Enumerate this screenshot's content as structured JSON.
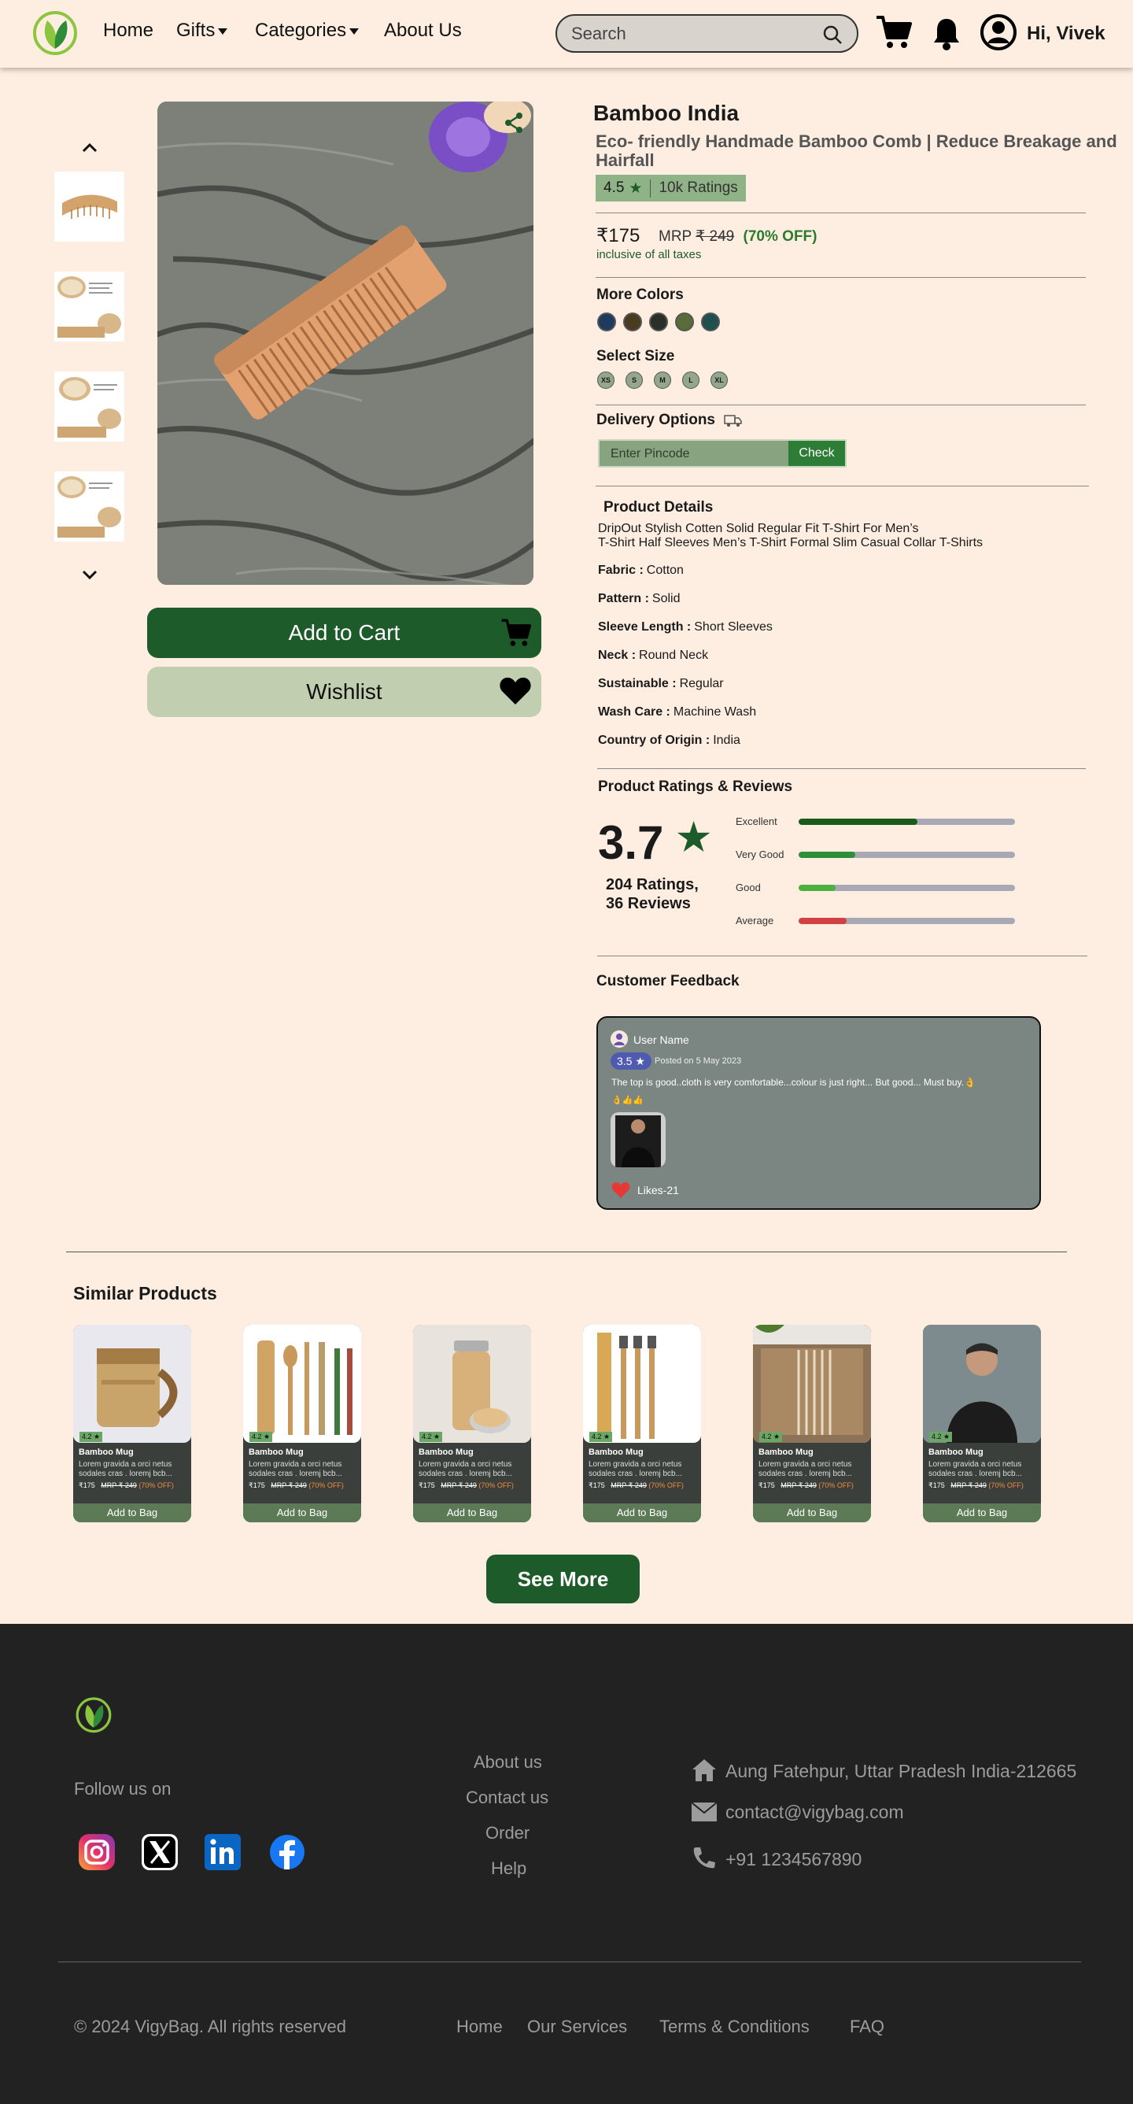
{
  "nav": {
    "home": "Home",
    "gifts": "Gifts",
    "categories": "Categories",
    "about": "About Us",
    "search_placeholder": "Search",
    "greeting": "Hi, Vivek"
  },
  "product": {
    "brand": "Bamboo India",
    "title": "Eco- friendly Handmade Bamboo Comb | Reduce Breakage and Hairfall",
    "rating": "4.5",
    "rating_count": "10k Ratings",
    "price": "₹175",
    "mrp_label": "MRP",
    "mrp_value": "₹ 249",
    "discount": "(70% OFF)",
    "tax_note": "inclusive of all taxes",
    "add_to_cart": "Add to Cart",
    "wishlist": "Wishlist"
  },
  "colors": {
    "title": "More Colors",
    "swatches": [
      "#1f3a5f",
      "#4a3a1f",
      "#2b2f2a",
      "#5a6b3a",
      "#1f4f4f"
    ]
  },
  "sizes": {
    "title": "Select Size",
    "options": [
      "XS",
      "S",
      "M",
      "L",
      "XL"
    ]
  },
  "delivery": {
    "title": "Delivery Options",
    "placeholder": "Enter Pincode",
    "check": "Check"
  },
  "details": {
    "title": "Product Details",
    "desc_line1": "DripOut Stylish Cotten Solid Regular Fit T-Shirt For Men’s",
    "desc_line2": "T-Shirt Half Sleeves Men’s T-Shirt Formal Slim Casual Collar T-Shirts",
    "attributes": [
      {
        "label": "Fabric :",
        "value": "Cotton"
      },
      {
        "label": "Pattern :",
        "value": "Solid"
      },
      {
        "label": "Sleeve Length :",
        "value": "Short Sleeves"
      },
      {
        "label": "Neck :",
        "value": "Round Neck"
      },
      {
        "label": "Sustainable :",
        "value": "Regular"
      },
      {
        "label": "Wash Care :",
        "value": "Machine Wash"
      },
      {
        "label": "Country of Origin :",
        "value": "India"
      }
    ]
  },
  "ratings": {
    "title": "Product Ratings & Reviews",
    "average": "3.7",
    "count_line1": "204 Ratings,",
    "count_line2": "36 Reviews",
    "bars": [
      {
        "label": "Excellent",
        "fraction": 0.55,
        "color": "#1a5a1a"
      },
      {
        "label": "Very Good",
        "fraction": 0.26,
        "color": "#2e8f38"
      },
      {
        "label": "Good",
        "fraction": 0.17,
        "color": "#4caf3e"
      },
      {
        "label": "Average",
        "fraction": 0.22,
        "color": "#d24141"
      }
    ]
  },
  "feedback": {
    "title": "Customer Feedback",
    "user": "User Name",
    "score": "3.5 ★",
    "date": "Posted on 5 May 2023",
    "text": "The top is good..cloth is very comfortable...colour is just right... But good... Must buy.👌",
    "emoji": "👌👍👍",
    "likes": "Likes-21"
  },
  "similar": {
    "title": "Similar Products",
    "see_more": "See More",
    "items": [
      {
        "rating": "4.2 ★",
        "name": "Bamboo Mug",
        "desc": "Lorem gravida a orci netus sodales cras . loremj bcb...",
        "price": "₹175",
        "mrp": "MRP ₹ 249",
        "off": "(70% OFF)",
        "button": "Add to Bag"
      },
      {
        "rating": "4.2 ★",
        "name": "Bamboo Mug",
        "desc": "Lorem gravida a orci netus sodales cras . loremj bcb...",
        "price": "₹175",
        "mrp": "MRP ₹ 249",
        "off": "(70% OFF)",
        "button": "Add to Bag"
      },
      {
        "rating": "4.2 ★",
        "name": "Bamboo Mug",
        "desc": "Lorem gravida a orci netus sodales cras . loremj bcb...",
        "price": "₹175",
        "mrp": "MRP ₹ 249",
        "off": "(70% OFF)",
        "button": "Add to Bag"
      },
      {
        "rating": "4.2 ★",
        "name": "Bamboo Mug",
        "desc": "Lorem gravida a orci netus sodales cras . loremj bcb...",
        "price": "₹175",
        "mrp": "MRP ₹ 249",
        "off": "(70% OFF)",
        "button": "Add to Bag"
      },
      {
        "rating": "4.2 ★",
        "name": "Bamboo Mug",
        "desc": "Lorem gravida a orci netus sodales cras . loremj bcb...",
        "price": "₹175",
        "mrp": "MRP ₹ 249",
        "off": "(70% OFF)",
        "button": "Add to Bag"
      },
      {
        "rating": "4.2 ★",
        "name": "Bamboo Mug",
        "desc": "Lorem gravida a orci netus sodales cras . loremj bcb...",
        "price": "₹175",
        "mrp": "MRP ₹ 249",
        "off": "(70% OFF)",
        "button": "Add to Bag"
      }
    ]
  },
  "footer": {
    "follow": "Follow us on",
    "links": [
      "About us",
      "Contact us",
      "Order",
      "Help"
    ],
    "address": "Aung Fatehpur, Uttar Pradesh India-212665",
    "email": "contact@vigybag.com",
    "phone": "+91 1234567890",
    "copyright": "© 2024 VigyBag. All rights reserved",
    "bottom_links": [
      "Home",
      "Our Services",
      "Terms & Conditions",
      "FAQ"
    ]
  }
}
